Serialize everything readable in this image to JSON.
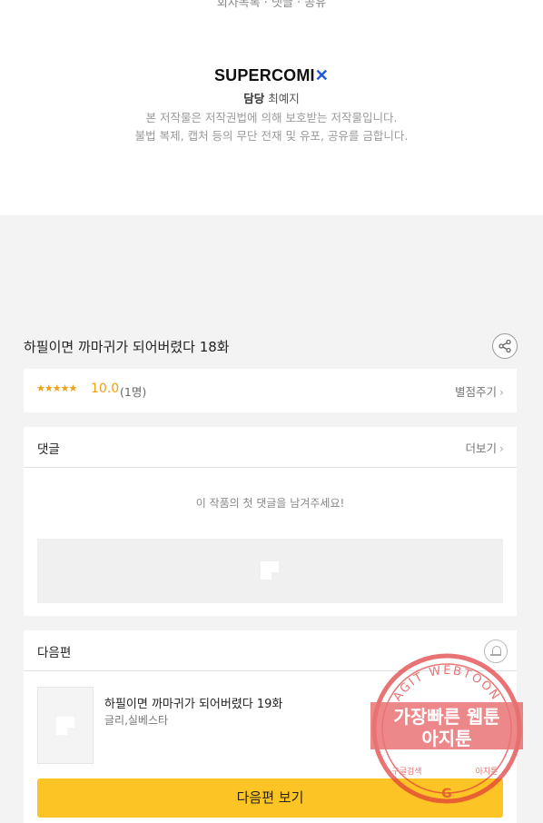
{
  "top": {
    "cut_text": "회차목록 · 댓글 · 공유",
    "logo_main": "SUPERCOMI",
    "logo_x": "✕",
    "credit_role": "담당",
    "credit_name": "최예지",
    "notice_1": "본 저작물은 저작권법에 의해 보호받는 저작물입니다.",
    "notice_2": "불법 복제, 캡처 등의 무단 전재 및 유포, 공유를 금합니다."
  },
  "episode": {
    "title": "하필이면 까마귀가 되어버렸다 18화",
    "share_icon": "share-icon"
  },
  "rating": {
    "stars": "★★★★★",
    "score": "10.0",
    "count": "(1명)",
    "rate_link": "별점주기",
    "chevron": "›"
  },
  "comments": {
    "label": "댓글",
    "more_link": "더보기",
    "chevron": "›",
    "empty_message": "이 작품의 첫 댓글을 남겨주세요!"
  },
  "next_episode": {
    "label": "다음편",
    "title": "하필이면 까마귀가 되어버렸다 19화",
    "authors": "글리,실베스타",
    "button_label": "다음편 보기",
    "bell_icon": "bell-icon"
  },
  "watermark": {
    "ring_text": "AGIT WEBTOON",
    "line_1": "가장빠른 웹툰",
    "line_2": "아지툰",
    "left_small": "구글검색",
    "right_small": "아지툰",
    "center_letter": "G"
  },
  "colors": {
    "accent_yellow": "#fcc425",
    "star_orange": "#f0a010",
    "logo_blue": "#1f56e0",
    "stamp_red": "#e0383a"
  }
}
